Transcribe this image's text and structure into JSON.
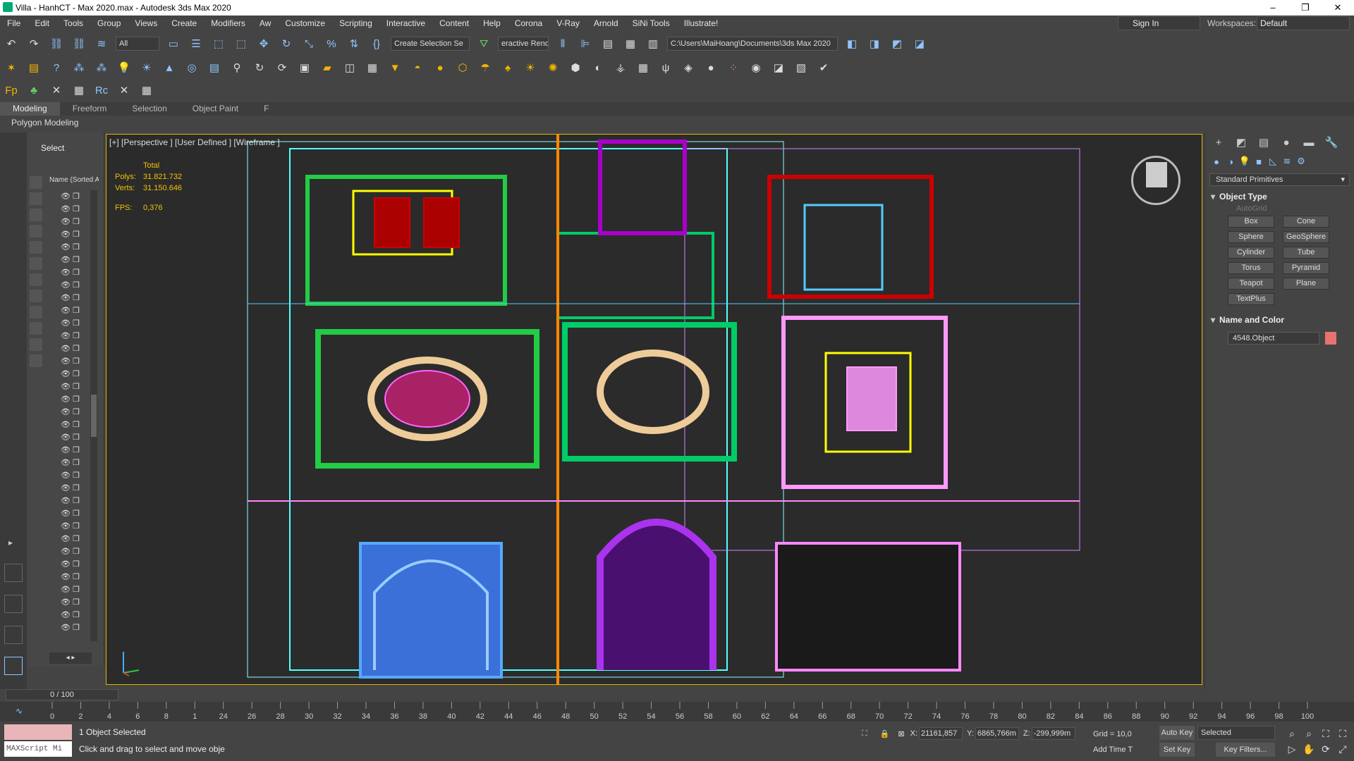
{
  "window": {
    "title": "Villa - HanhCT - Max 2020.max - Autodesk 3ds Max 2020"
  },
  "menu": [
    "File",
    "Edit",
    "Tools",
    "Group",
    "Views",
    "Create",
    "Modifiers",
    "Aw",
    "Customize",
    "Scripting",
    "Interactive",
    "Content",
    "Help",
    "Corona",
    "V-Ray",
    "Arnold",
    "SiNi Tools",
    "Illustrate!"
  ],
  "account": {
    "sign_in": "Sign In",
    "workspaces_label": "Workspaces:",
    "workspace": "Default"
  },
  "toolbar": {
    "filter": "All",
    "selection_set": "Create Selection Se",
    "interactive_render": "eractive Rendi",
    "project_path": "C:\\Users\\MaiHoang\\Documents\\3ds Max 2020"
  },
  "ribbon": {
    "tabs": [
      "Modeling",
      "Freeform",
      "Selection",
      "Object Paint",
      "F"
    ],
    "active": "Modeling",
    "panel": "Polygon Modeling"
  },
  "scene_explorer": {
    "mode": "Select",
    "column_header": "Name (Sorted A"
  },
  "viewport": {
    "label": "[+] [Perspective ] [User Defined ] [Wireframe ]",
    "stats_title": "Total",
    "polys_label": "Polys:",
    "polys": "31.821.732",
    "verts_label": "Verts:",
    "verts": "31.150.646",
    "fps_label": "FPS:",
    "fps": "0,376"
  },
  "command_panel": {
    "category": "Standard Primitives",
    "object_type_title": "Object Type",
    "autogrid": "AutoGrid",
    "primitives": [
      "Box",
      "Cone",
      "Sphere",
      "GeoSphere",
      "Cylinder",
      "Tube",
      "Torus",
      "Pyramid",
      "Teapot",
      "Plane",
      "TextPlus"
    ],
    "name_color_title": "Name and Color",
    "object_name": "4548.Object",
    "object_color": "#e8736e"
  },
  "timeline": {
    "frame": "0 / 100",
    "ticks": [
      "0",
      "2",
      "4",
      "6",
      "8",
      "1",
      "24",
      "26",
      "28",
      "30",
      "32",
      "34",
      "36",
      "38",
      "40",
      "42",
      "44",
      "46",
      "48",
      "50",
      "52",
      "54",
      "56",
      "58",
      "60",
      "62",
      "64",
      "66",
      "68",
      "70",
      "72",
      "74",
      "76",
      "78",
      "80",
      "82",
      "84",
      "86",
      "88",
      "90",
      "92",
      "94",
      "96",
      "98",
      "100"
    ]
  },
  "status": {
    "selected": "1 Object Selected",
    "prompt": "Click and drag to select and move obje",
    "maxscript": "MAXScript Mi",
    "x_label": "X:",
    "x": "21161,857",
    "y_label": "Y:",
    "y": "6865,766m",
    "z_label": "Z:",
    "z": "-299,999m",
    "grid": "Grid = 10,0",
    "add_time_tag": "Add Time T",
    "auto_key": "Auto Key",
    "set_key": "Set Key",
    "key_mode": "Selected",
    "key_filters": "Key Filters..."
  }
}
